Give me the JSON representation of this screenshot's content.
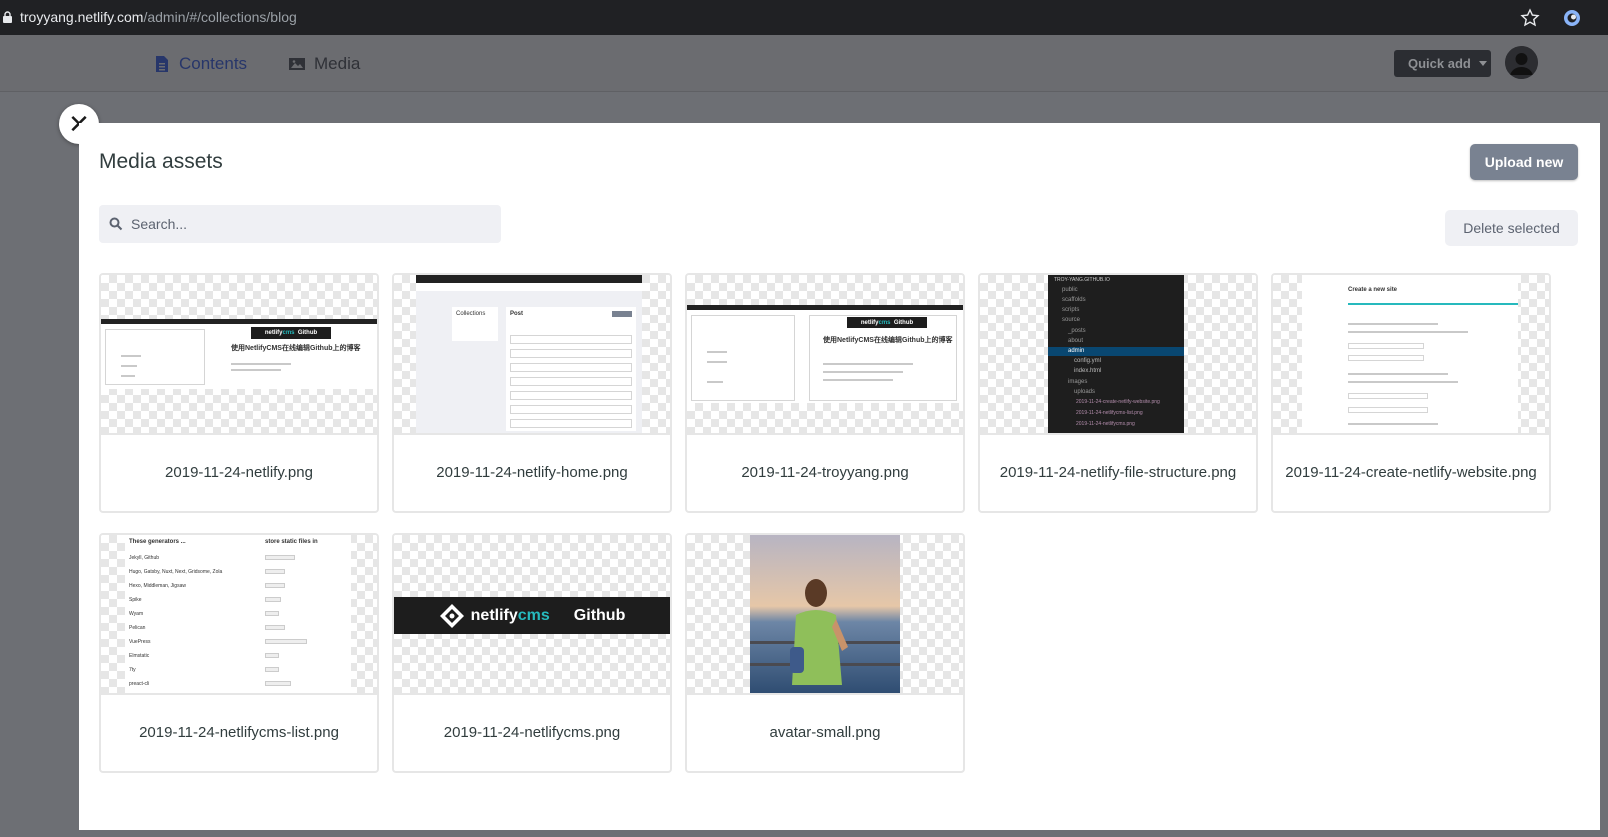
{
  "browser": {
    "url_host": "troyyang.netlify.com",
    "url_path": "/admin/#/collections/blog"
  },
  "header": {
    "nav": [
      {
        "label": "Contents",
        "icon": "document-icon"
      },
      {
        "label": "Media",
        "icon": "image-icon"
      }
    ],
    "quick_add": "Quick add"
  },
  "modal": {
    "title": "Media assets",
    "upload_label": "Upload new",
    "search_placeholder": "Search...",
    "delete_label": "Delete selected",
    "close_glyph": "✕",
    "assets": [
      {
        "name": "2019-11-24-netlify.png"
      },
      {
        "name": "2019-11-24-netlify-home.png"
      },
      {
        "name": "2019-11-24-troyyang.png"
      },
      {
        "name": "2019-11-24-netlify-file-structure.png"
      },
      {
        "name": "2019-11-24-create-netlify-website.png"
      },
      {
        "name": "2019-11-24-netlifycms-list.png"
      },
      {
        "name": "2019-11-24-netlifycms.png"
      },
      {
        "name": "avatar-small.png"
      }
    ]
  },
  "thumbs": {
    "netlify_banner_brand": "netlify",
    "netlify_banner_cms": "cms",
    "netlify_banner_github": "Github",
    "blog_title": "使用NetlifyCMS在线编辑Github上的博客",
    "collections_label": "Collections",
    "post_label": "Post",
    "tree_root": "TROY-YANG.GITHUB.IO",
    "tree_items": [
      "public",
      "scaffolds",
      "scripts",
      "source",
      "_posts",
      "about",
      "admin",
      "config.yml",
      "index.html",
      "images",
      "uploads",
      "2019-11-24-create-netlify-website.png",
      "2019-11-24-netlifycms-list.png",
      "2019-11-24-netlifycms.png"
    ],
    "create_site_title": "Create a new site",
    "list_header_left": "These generators ...",
    "list_header_right": "store static files in",
    "list_rows": [
      "Jekyll, Github",
      "Hugo, Gatsby, Nuxt, Next, Gridsome, Zola",
      "Hexo, Middleman, Jigsaw",
      "Spike",
      "Wyam",
      "Pelican",
      "VuePress",
      "Elmstatic",
      "7ty",
      "preact-cli"
    ]
  },
  "colors": {
    "accent": "#798291",
    "nav_active": "#27366a",
    "overlay": "#6d6f74"
  }
}
